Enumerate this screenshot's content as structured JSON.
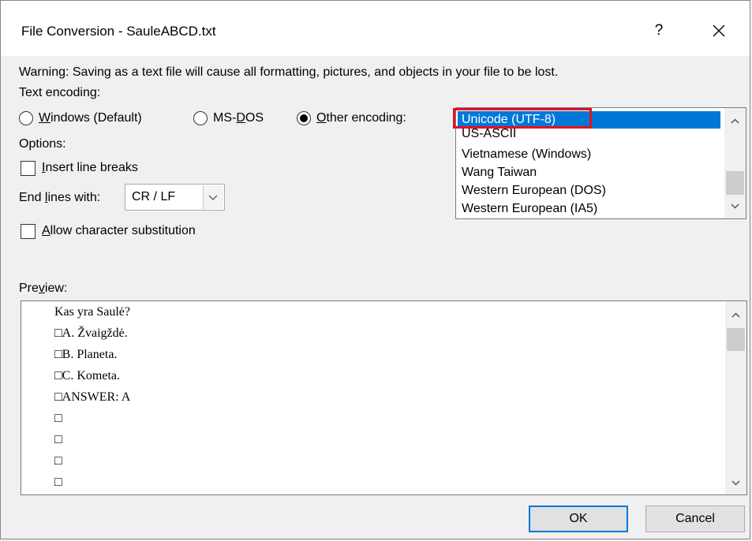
{
  "dialog": {
    "title": "File Conversion - SauleABCD.txt",
    "help_label": "?",
    "warning": "Warning: Saving as a text file will cause all formatting, pictures, and objects in your file to be lost."
  },
  "encoding": {
    "label": "Text encoding:",
    "options": [
      {
        "pre": "",
        "key": "W",
        "post": "indows (Default)",
        "checked": false
      },
      {
        "pre": "MS-",
        "key": "D",
        "post": "OS",
        "checked": false
      },
      {
        "pre": "",
        "key": "O",
        "post": "ther encoding:",
        "checked": true
      }
    ],
    "list": [
      "Unicode (UTF-8)",
      "US-ASCII",
      "Vietnamese (Windows)",
      "Wang Taiwan",
      "Western European (DOS)",
      "Western European (IA5)"
    ],
    "selected_index": 0
  },
  "options": {
    "label": "Options:",
    "insert_line_breaks": {
      "pre": "",
      "key": "I",
      "post": "nsert line breaks",
      "checked": false
    },
    "end_lines": {
      "pre": "End ",
      "key": "l",
      "post": "ines with:",
      "value": "CR / LF"
    },
    "allow_substitution": {
      "pre": "",
      "key": "A",
      "post": "llow character substitution",
      "checked": false
    }
  },
  "preview": {
    "label_pre": "Pre",
    "label_key": "v",
    "label_post": "iew:",
    "lines": [
      "Kas yra Saulė?",
      "□A. Žvaigždė.",
      "□B. Planeta.",
      "□C. Kometa.",
      "□ANSWER: A",
      "□",
      "□",
      "□",
      "□"
    ]
  },
  "buttons": {
    "ok": "OK",
    "cancel": "Cancel"
  },
  "colors": {
    "selection": "#0078d7",
    "annotation_box": "#e8101e",
    "default_button_border": "#0078d7"
  }
}
